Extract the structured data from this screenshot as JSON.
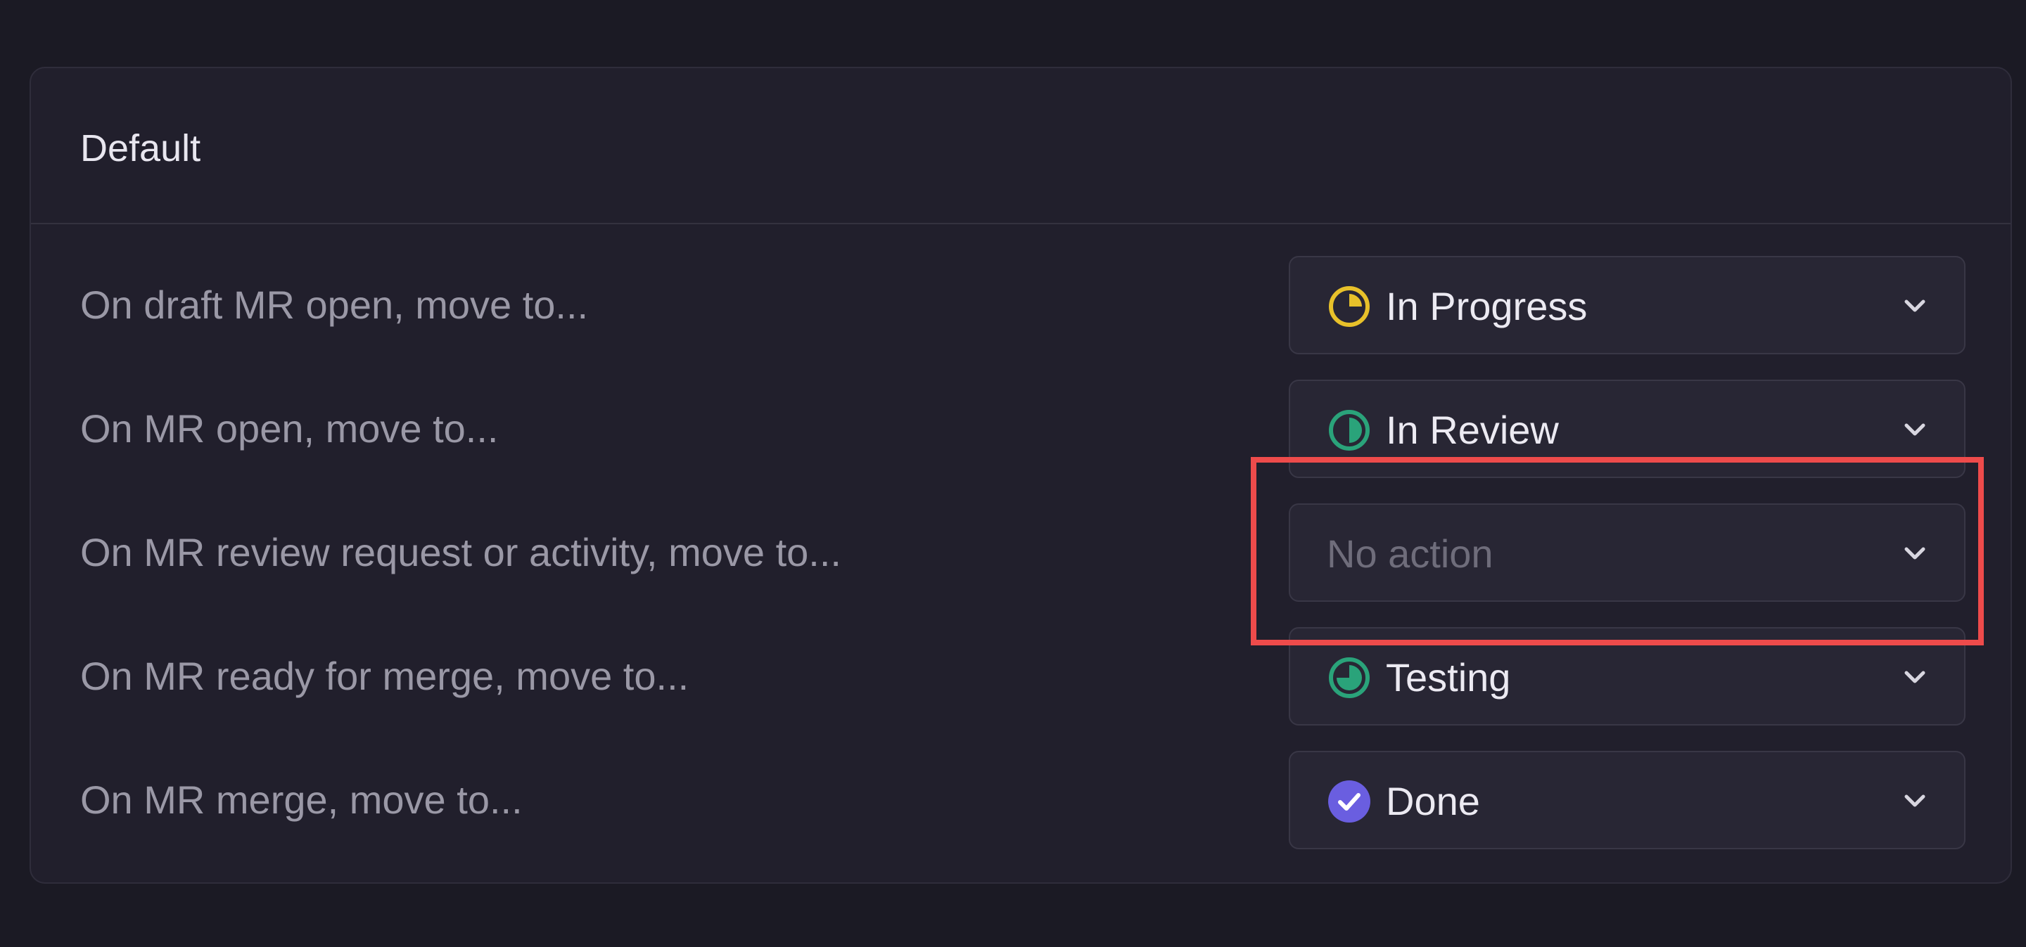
{
  "card": {
    "title": "Default"
  },
  "rules": [
    {
      "label": "On draft MR open, move to...",
      "value": "In Progress",
      "icon": "in-progress-icon",
      "color": "#e8c12a",
      "placeholder": false
    },
    {
      "label": "On MR open, move to...",
      "value": "In Review",
      "icon": "in-review-icon",
      "color": "#2aa37a",
      "placeholder": false
    },
    {
      "label": "On MR review request or activity, move to...",
      "value": "No action",
      "icon": "",
      "color": "#6f6d7b",
      "placeholder": true
    },
    {
      "label": "On MR ready for merge, move to...",
      "value": "Testing",
      "icon": "testing-icon",
      "color": "#2aa37a",
      "placeholder": false
    },
    {
      "label": "On MR merge, move to...",
      "value": "Done",
      "icon": "done-icon",
      "color": "#6a5ee0",
      "placeholder": false
    }
  ],
  "colors": {
    "background": "#1b1a24",
    "card": "#211f2c",
    "highlight": "#ee4b4b"
  }
}
